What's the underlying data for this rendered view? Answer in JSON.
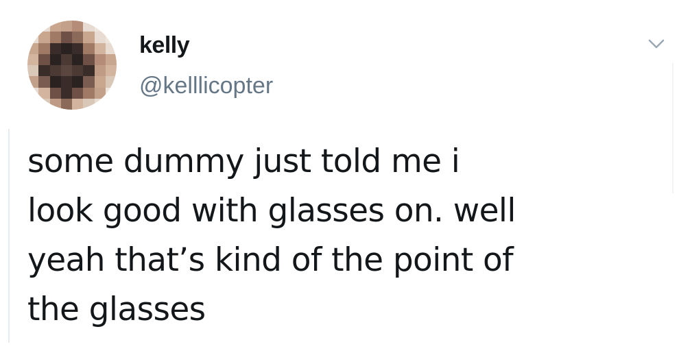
{
  "user": {
    "display_name": "kelly",
    "handle": "@kelllicopter",
    "avatar_icon": "pixelated-avatar-icon"
  },
  "menu": {
    "icon": "chevron-down-icon"
  },
  "tweet": {
    "lines": [
      "some dummy just told me i",
      "look good with glasses on. well",
      "yeah that’s kind of the point of",
      "the glasses"
    ]
  },
  "colors": {
    "name": "#14171a",
    "handle": "#657786",
    "caret": "#9aa8b4"
  }
}
